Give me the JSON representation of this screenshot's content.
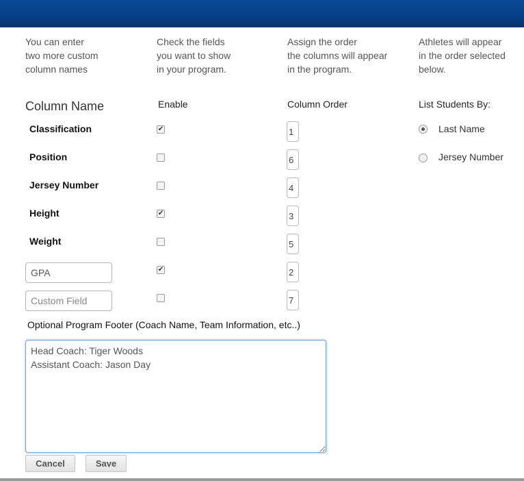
{
  "intro": {
    "custom_names": "You can enter\ntwo more custom\ncolumn names",
    "check_fields": "Check the fields\nyou want to show\nin your program.",
    "assign_order": "Assign the order\nthe columns will appear\nin the program.",
    "athletes_order": "Athletes will appear\nin the order selected\nbelow."
  },
  "headers": {
    "column_name": "Column Name",
    "enable": "Enable",
    "column_order": "Column Order",
    "list_by": "List Students By:"
  },
  "fields": [
    {
      "label": "Classification",
      "enabled": true,
      "order": "1"
    },
    {
      "label": "Position",
      "enabled": false,
      "order": "6"
    },
    {
      "label": "Jersey Number",
      "enabled": false,
      "order": "4"
    },
    {
      "label": "Height",
      "enabled": true,
      "order": "3"
    },
    {
      "label": "Weight",
      "enabled": false,
      "order": "5"
    }
  ],
  "custom_fields": [
    {
      "value": "GPA",
      "placeholder": "",
      "enabled": true,
      "order": "2"
    },
    {
      "value": "",
      "placeholder": "Custom Field",
      "enabled": false,
      "order": "7"
    }
  ],
  "list_options": [
    {
      "label": "Last Name",
      "selected": true
    },
    {
      "label": "Jersey Number",
      "selected": false
    }
  ],
  "footer": {
    "label": "Optional Program Footer (Coach Name, Team Information, etc..)",
    "text": "Head Coach: Tiger Woods\nAssistant Coach: Jason Day"
  },
  "buttons": {
    "cancel": "Cancel",
    "save": "Save"
  },
  "colors": {
    "topbar": "#083e85",
    "focus_border": "#6ea6e0"
  },
  "icons": {
    "check": "checkmark-icon"
  }
}
